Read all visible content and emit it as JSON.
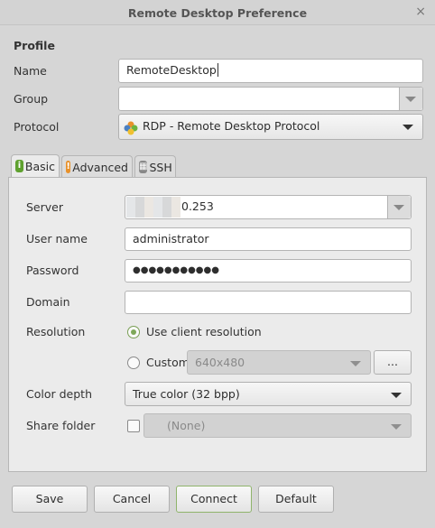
{
  "window": {
    "title": "Remote Desktop Preference",
    "close": "×"
  },
  "profile": {
    "heading": "Profile",
    "name_label": "Name",
    "name_value": "RemoteDesktop",
    "group_label": "Group",
    "group_value": "",
    "protocol_label": "Protocol",
    "protocol_value": "RDP - Remote Desktop Protocol"
  },
  "tabs": [
    {
      "label": "Basic",
      "icon": "info-icon",
      "color": "#5fa12f"
    },
    {
      "label": "Advanced",
      "icon": "warning-icon",
      "color": "#e8912a"
    },
    {
      "label": "SSH",
      "icon": "terminal-icon",
      "color": "#888888"
    }
  ],
  "basic": {
    "server_label": "Server",
    "server_value": "0.253",
    "username_label": "User name",
    "username_value": "administrator",
    "password_label": "Password",
    "password_value": "●●●●●●●●●●●",
    "domain_label": "Domain",
    "domain_value": "",
    "resolution_label": "Resolution",
    "res_client": "Use client resolution",
    "res_custom": "Custom",
    "res_custom_value": "640x480",
    "res_more": "...",
    "colordepth_label": "Color depth",
    "colordepth_value": "True color (32 bpp)",
    "share_label": "Share folder",
    "share_value": "(None)"
  },
  "buttons": {
    "save": "Save",
    "cancel": "Cancel",
    "connect": "Connect",
    "default": "Default"
  }
}
